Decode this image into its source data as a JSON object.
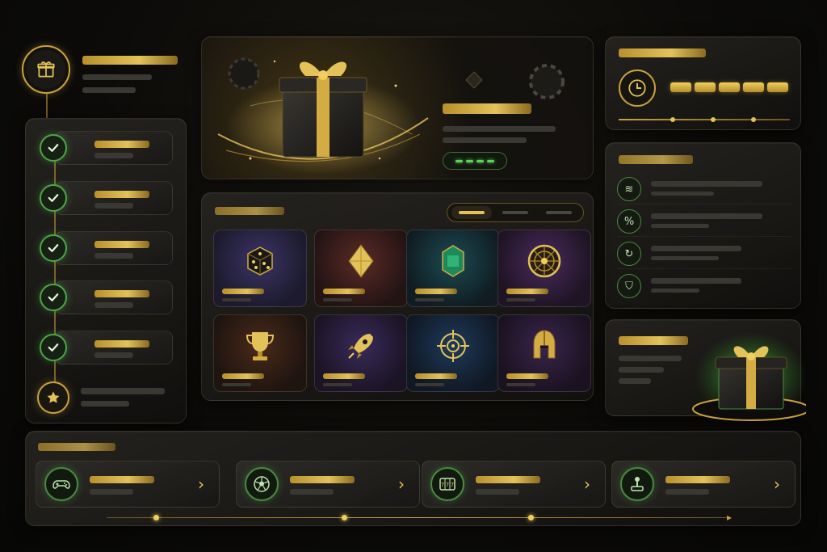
{
  "colors": {
    "accent_gold": "#e3c25a",
    "accent_green": "#5ed456",
    "background": "#0c0b09",
    "panel": "#1c1b18"
  },
  "profile": {
    "icon": "gift-icon"
  },
  "checklist": {
    "items": [
      {
        "status": "completed",
        "icon": "check-icon"
      },
      {
        "status": "completed",
        "icon": "check-icon"
      },
      {
        "status": "completed",
        "icon": "check-icon"
      },
      {
        "status": "completed",
        "icon": "check-icon"
      },
      {
        "status": "completed",
        "icon": "check-icon"
      },
      {
        "status": "locked",
        "icon": "star-icon"
      }
    ]
  },
  "hero": {
    "image": "gift-box-illustration",
    "button_icon": "progress-dashes-icon"
  },
  "timer": {
    "icon": "clock-icon",
    "segments_filled": 5,
    "segments_total": 5
  },
  "features": {
    "items": [
      {
        "icon": "coins-stack-icon",
        "glyph": "≋"
      },
      {
        "icon": "percent-icon",
        "glyph": "%"
      },
      {
        "icon": "refresh-icon",
        "glyph": "↻"
      },
      {
        "icon": "shield-icon",
        "glyph": "⛉"
      }
    ]
  },
  "games": {
    "filters": [
      {
        "active": true
      },
      {
        "active": false
      },
      {
        "active": false
      }
    ],
    "tiles": [
      {
        "icon": "dice-icon"
      },
      {
        "icon": "diamond-icon"
      },
      {
        "icon": "gem-icon"
      },
      {
        "icon": "roulette-wheel-icon"
      },
      {
        "icon": "trophy-icon"
      },
      {
        "icon": "rocket-icon"
      },
      {
        "icon": "crosshair-icon"
      },
      {
        "icon": "spartan-helmet-icon"
      }
    ]
  },
  "promo": {
    "image": "glowing-gift-box"
  },
  "categories": {
    "items": [
      {
        "icon": "gamepad-icon",
        "chevron": "›"
      },
      {
        "icon": "soccer-ball-icon",
        "chevron": "›"
      },
      {
        "icon": "slot-machine-icon",
        "chevron": "›"
      },
      {
        "icon": "joystick-icon",
        "chevron": "›"
      }
    ]
  }
}
